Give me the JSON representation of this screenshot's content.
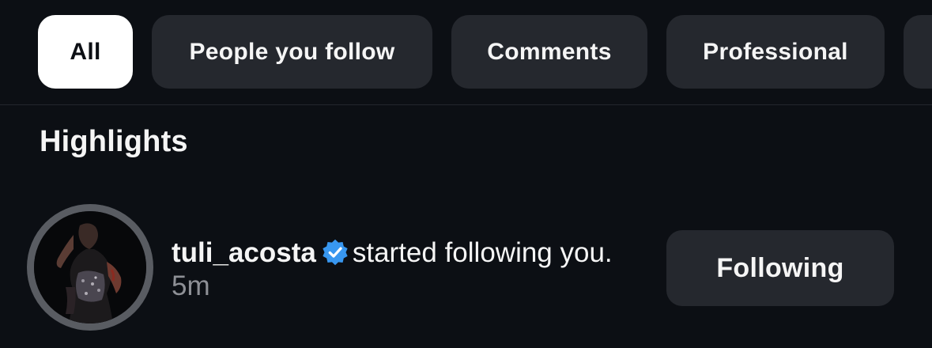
{
  "filters": {
    "chips": [
      {
        "label": "All",
        "active": true
      },
      {
        "label": "People you follow",
        "active": false
      },
      {
        "label": "Comments",
        "active": false
      },
      {
        "label": "Professional",
        "active": false
      },
      {
        "label": "",
        "active": false
      }
    ]
  },
  "section": {
    "title": "Highlights"
  },
  "notification": {
    "username": "tuli_acosta",
    "verified": true,
    "action_text": "started following you.",
    "time": "5m",
    "button_label": "Following",
    "avatar_icon": "profile-photo",
    "verified_icon": "verified-badge-icon"
  },
  "colors": {
    "background": "#0c0f14",
    "chip_bg": "#25282e",
    "chip_active_bg": "#ffffff",
    "verified_blue": "#3897f0",
    "muted_text": "#8e9096"
  }
}
